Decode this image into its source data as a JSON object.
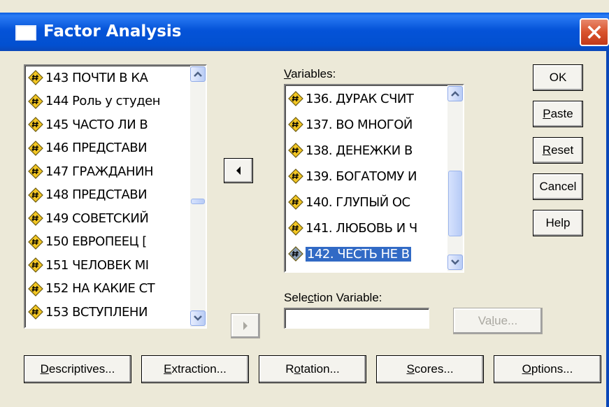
{
  "window": {
    "title": "Factor Analysis"
  },
  "source_list": {
    "items": [
      "143 ПОЧТИ В КА",
      "144 Роль у студен",
      "145 ЧАСТО ЛИ В",
      "146 ПРЕДСТАВИ",
      "147 ГРАЖДАНИН",
      "148 ПРЕДСТАВИ",
      "149 СОВЕТСКИЙ",
      "150 ЕВРОПЕЕЦ [",
      "151 ЧЕЛОВЕК МІ",
      "152 НА КАКИЕ СТ",
      "153 ВСТУПЛЕНИ"
    ]
  },
  "variables": {
    "label_v": "V",
    "label_rest": "ariables:",
    "items": [
      "136. ДУРАК СЧИТ",
      "137. ВО МНОГОЙ",
      "138. ДЕНЕЖКИ В",
      "139. БОГАТОМУ И",
      "140. ГЛУПЫЙ ОС",
      "141. ЛЮБОВЬ И Ч",
      "142. ЧЕСТЬ НЕ В"
    ],
    "selected_index": 6
  },
  "selection_variable": {
    "label_pre": "Sele",
    "label_u": "c",
    "label_post": "tion Variable:",
    "value": ""
  },
  "buttons": {
    "ok": "OK",
    "paste_u": "P",
    "paste_rest": "aste",
    "reset_u": "R",
    "reset_rest": "eset",
    "cancel": "Cancel",
    "help": "Help",
    "value_pre": "Va",
    "value_u": "l",
    "value_post": "ue...",
    "descriptives_u": "D",
    "descriptives_rest": "escriptives...",
    "extraction_u": "E",
    "extraction_rest": "xtraction...",
    "rotation_pre": "R",
    "rotation_u": "o",
    "rotation_post": "tation...",
    "scores_u": "S",
    "scores_rest": "cores...",
    "options_u": "O",
    "options_rest": "ptions..."
  },
  "colors": {
    "titlebar": "#0553d8",
    "selection": "#316ac5",
    "dialog_bg": "#ece9d8"
  }
}
